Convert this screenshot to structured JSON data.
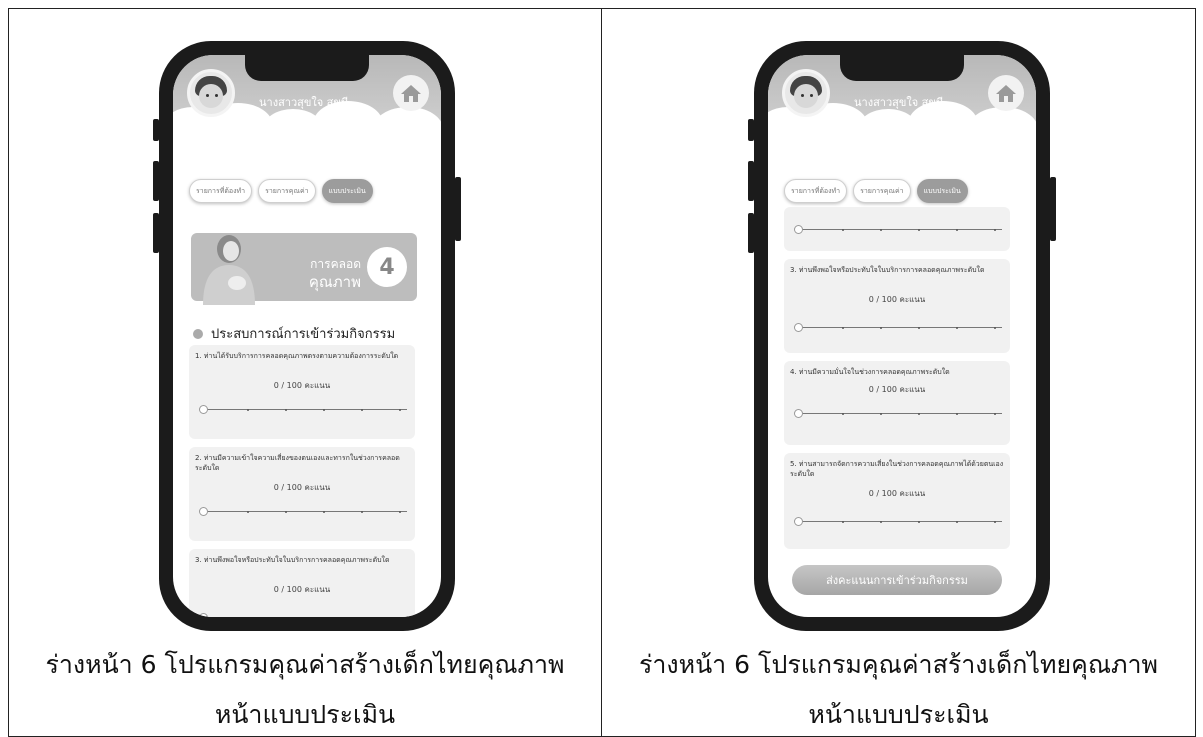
{
  "captions": {
    "line1": "ร่างหน้า 6 โปรแกรมคุณค่าสร้างเด็กไทยคุณภาพ",
    "line2": "หน้าแบบประเมิน"
  },
  "app": {
    "user_name": "นางสาวสุขใจ สุขมี",
    "tabs": [
      "รายการที่ต้องทำ",
      "รายการคุณค่า",
      "แบบประเมิน"
    ],
    "active_tab": "แบบประเมิน",
    "banner_title_1": "การคลอด",
    "banner_title_2": "คุณภาพ",
    "banner_number": "4",
    "section_title": "ประสบการณ์การเข้าร่วมกิจกรรม",
    "submit_label": "ส่งคะแนนการเข้าร่วมกิจกรรม"
  },
  "questions": {
    "q1": "1. ท่านได้รับบริการการคลอดคุณภาพตรงตามความต้องการระดับใด",
    "q2": "2. ท่านมีความเข้าใจความเสี่ยงของตนเองและทารกในช่วงการคลอดระดับใด",
    "q3": "3. ท่านพึงพอใจหรือประทับใจในบริการการคลอดคุณภาพระดับใด",
    "q4": "4. ท่านมีความมั่นใจในช่วงการคลอดคุณภาพระดับใด",
    "q5": "5. ท่านสามารถจัดการความเสี่ยงในช่วงการคลอดคุณภาพได้ด้วยตนเองระดับใด",
    "score_text": "0 / 100 คะแนน"
  },
  "colors": {
    "accent": "#9c9c9c",
    "header": "#c4c4c4",
    "card": "#f1f1f1"
  }
}
